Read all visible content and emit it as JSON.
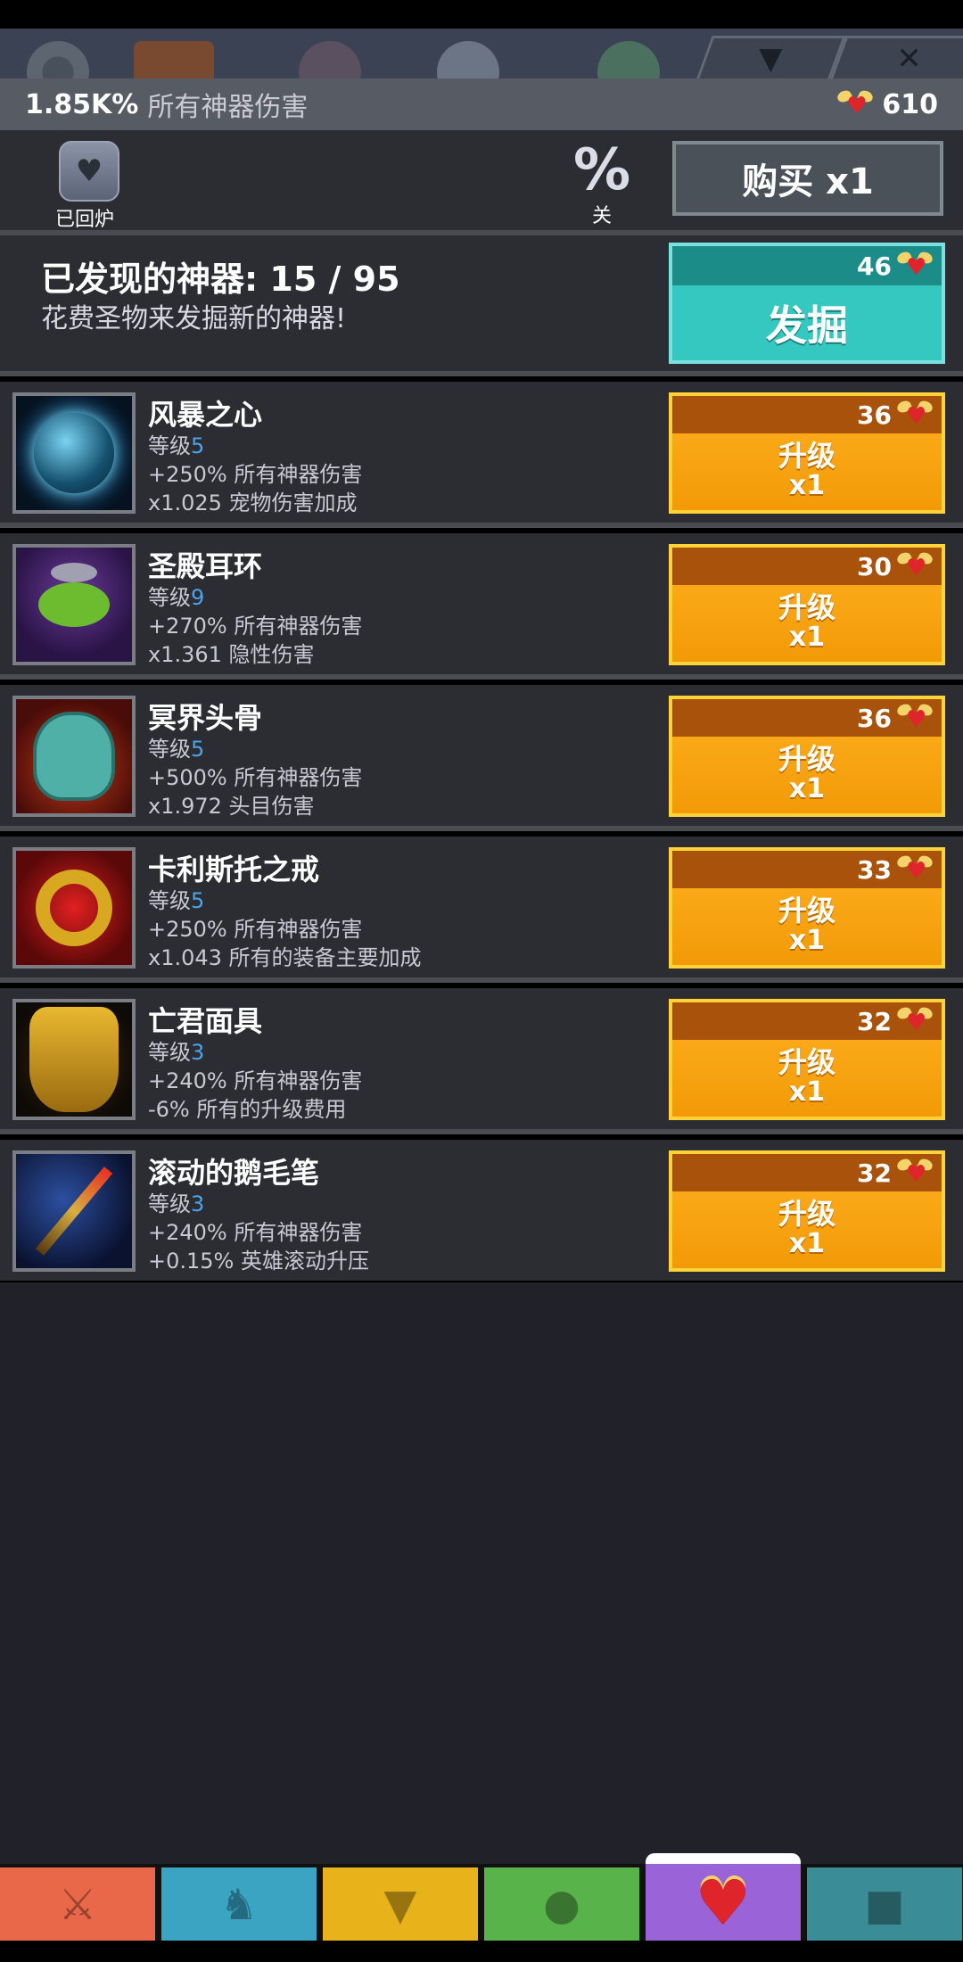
{
  "header": {
    "collapse_icon": "▼",
    "close_icon": "✕"
  },
  "summary": {
    "percent": "1.85K%",
    "label": "所有神器伤害",
    "relics": "610"
  },
  "controls": {
    "salvaged_label": "已回炉",
    "percent_symbol": "%",
    "percent_toggle_label": "关",
    "buy_label": "购买 x1"
  },
  "discover": {
    "title": "已发现的神器: 15 / 95",
    "subtitle": "花费圣物来发掘新的神器!",
    "cost": "46",
    "button_label": "发掘"
  },
  "artifacts": [
    {
      "name": "风暴之心",
      "level_label": "等级",
      "level": "5",
      "bonus1": "+250% 所有神器伤害",
      "bonus2": "x1.025 宠物伤害加成",
      "cost": "36",
      "upgrade_label": "升级",
      "multiplier": "x1"
    },
    {
      "name": "圣殿耳环",
      "level_label": "等级",
      "level": "9",
      "bonus1": "+270% 所有神器伤害",
      "bonus2": "x1.361 隐性伤害",
      "cost": "30",
      "upgrade_label": "升级",
      "multiplier": "x1"
    },
    {
      "name": "冥界头骨",
      "level_label": "等级",
      "level": "5",
      "bonus1": "+500% 所有神器伤害",
      "bonus2": "x1.972 头目伤害",
      "cost": "36",
      "upgrade_label": "升级",
      "multiplier": "x1"
    },
    {
      "name": "卡利斯托之戒",
      "level_label": "等级",
      "level": "5",
      "bonus1": "+250% 所有神器伤害",
      "bonus2": "x1.043 所有的装备主要加成",
      "cost": "33",
      "upgrade_label": "升级",
      "multiplier": "x1"
    },
    {
      "name": "亡君面具",
      "level_label": "等级",
      "level": "3",
      "bonus1": "+240% 所有神器伤害",
      "bonus2": "-6% 所有的升级费用",
      "cost": "32",
      "upgrade_label": "升级",
      "multiplier": "x1"
    },
    {
      "name": "滚动的鹅毛笔",
      "level_label": "等级",
      "level": "3",
      "bonus1": "+240% 所有神器伤害",
      "bonus2": "+0.15% 英雄滚动升压",
      "cost": "32",
      "upgrade_label": "升级",
      "multiplier": "x1"
    }
  ],
  "colors": {
    "accent_teal": "#35c8c0",
    "upgrade_orange": "#f29a08",
    "level_blue": "#4da3e8",
    "relic_red": "#e0242b"
  },
  "nav": [
    "sword-icon",
    "hero-icon",
    "equipment-icon",
    "pet-icon",
    "artifact-icon",
    "shop-icon"
  ]
}
